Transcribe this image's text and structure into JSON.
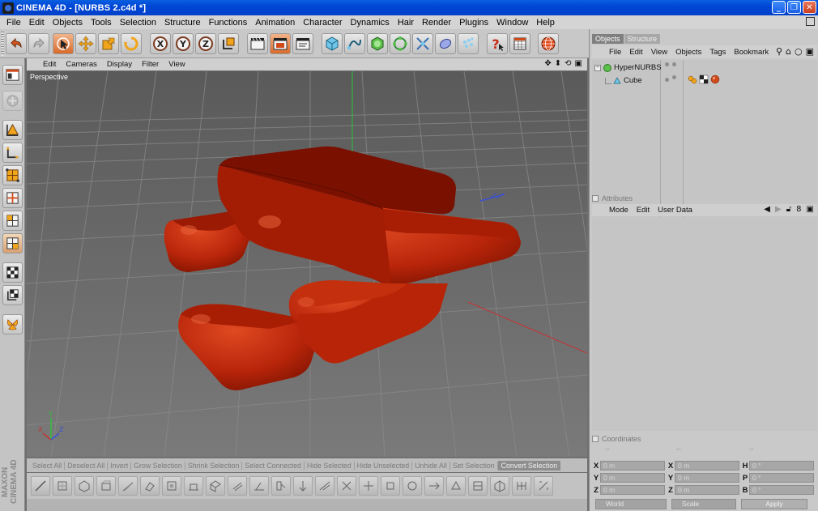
{
  "window": {
    "app_name": "CINEMA 4D",
    "document": "[NURBS 2.c4d *]",
    "title": "CINEMA 4D - [NURBS 2.c4d *]"
  },
  "menubar": {
    "items": [
      "File",
      "Edit",
      "Objects",
      "Tools",
      "Selection",
      "Structure",
      "Functions",
      "Animation",
      "Character",
      "Dynamics",
      "Hair",
      "Render",
      "Plugins",
      "Window",
      "Help"
    ]
  },
  "toolbar": {
    "buttons": [
      "undo-icon",
      "redo-icon",
      "live-selection-icon",
      "move-icon",
      "scale-icon",
      "rotate-icon",
      "x-axis-icon",
      "y-axis-icon",
      "z-axis-icon",
      "world-coordinates-icon",
      "render-view-icon",
      "render-picture-viewer-icon",
      "render-settings-icon",
      "cube-object-icon",
      "spline-pen-icon",
      "nurbs-icon",
      "array-icon",
      "deformer-icon",
      "environment-icon",
      "camera-icon",
      "light-icon",
      "help-icon",
      "timeline-icon",
      "web-icon"
    ]
  },
  "viewport": {
    "menu": [
      "Edit",
      "Cameras",
      "Display",
      "Filter",
      "View"
    ],
    "label": "Perspective",
    "object_color": "#c8200a",
    "axis_labels": {
      "x": "X",
      "y": "Y",
      "z": "Z"
    }
  },
  "command_bar": {
    "items": [
      "Select All",
      "Deselect All",
      "Invert",
      "Grow Selection",
      "Shrink Selection",
      "Select Connected",
      "Hide Selected",
      "Hide Unselected",
      "Unhide All",
      "Set Selection",
      "Convert Selection"
    ]
  },
  "left_toolbar": {
    "brand": "MAXON CINEMA 4D"
  },
  "objects_panel": {
    "tabs": [
      "Objects",
      "Structure"
    ],
    "menu": [
      "File",
      "Edit",
      "View",
      "Objects",
      "Tags",
      "Bookmark"
    ],
    "tree": [
      {
        "name": "HyperNURBS",
        "depth": 0,
        "expanded": true
      },
      {
        "name": "Cube",
        "depth": 1,
        "expanded": false
      }
    ]
  },
  "attributes_panel": {
    "title": "Attributes",
    "menu": [
      "Mode",
      "Edit",
      "User Data"
    ]
  },
  "coordinates_panel": {
    "title": "Coordinates",
    "column_headers": [
      "--",
      "--",
      "--"
    ],
    "rows": [
      {
        "pos_label": "X",
        "pos_value": "0 m",
        "size_label": "X",
        "size_value": "0 m",
        "rot_label": "H",
        "rot_value": "0 °"
      },
      {
        "pos_label": "Y",
        "pos_value": "0 m",
        "size_label": "Y",
        "size_value": "0 m",
        "rot_label": "P",
        "rot_value": "0 °"
      },
      {
        "pos_label": "Z",
        "pos_value": "0 m",
        "size_label": "Z",
        "size_value": "0 m",
        "rot_label": "B",
        "rot_value": "0 °"
      }
    ],
    "mode_select": "World",
    "size_select": "Scale",
    "apply_label": "Apply"
  }
}
